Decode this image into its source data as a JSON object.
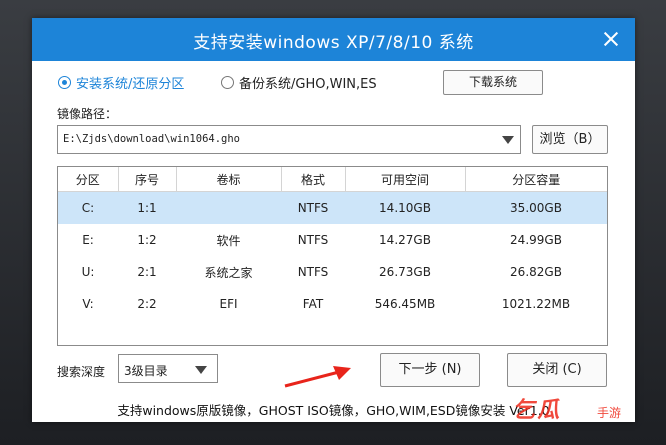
{
  "window": {
    "title": "支持安装windows XP/7/8/10 系统"
  },
  "mode": {
    "option_install": "安装系统/还原分区",
    "option_backup": "备份系统/GHO,WIN,ES",
    "selected": "option_install",
    "download_button": "下载系统"
  },
  "image_path": {
    "label": "镜像路径：",
    "value": "E:\\Zjds\\download\\win1064.gho",
    "browse_button": "浏览（B）"
  },
  "partitions": {
    "columns": [
      "分区",
      "序号",
      "卷标",
      "格式",
      "可用空间",
      "分区容量"
    ],
    "rows": [
      {
        "drive": "C:",
        "index": "1:1",
        "label": "",
        "fs": "NTFS",
        "free": "14.10GB",
        "size": "35.00GB",
        "selected": true
      },
      {
        "drive": "E:",
        "index": "1:2",
        "label": "软件",
        "fs": "NTFS",
        "free": "14.27GB",
        "size": "24.99GB",
        "selected": false
      },
      {
        "drive": "U:",
        "index": "2:1",
        "label": "系统之家",
        "fs": "NTFS",
        "free": "26.73GB",
        "size": "26.82GB",
        "selected": false
      },
      {
        "drive": "V:",
        "index": "2:2",
        "label": "EFI",
        "fs": "FAT",
        "free": "546.45MB",
        "size": "1021.22MB",
        "selected": false
      }
    ]
  },
  "search": {
    "label": "搜索深度",
    "value": "3级目录"
  },
  "buttons": {
    "next": "下一步 (N)",
    "close": "关闭 (C)"
  },
  "footer": {
    "text": "支持windows原版镜像，GHOST ISO镜像，GHO,WIM,ESD镜像安装 Ver1.0"
  },
  "watermark": {
    "text": "乞瓜",
    "sub": "手游"
  },
  "colors": {
    "titlebar": "#1d84d8",
    "accent": "#1d84d8",
    "selected_row": "#cde5f9",
    "arrow": "#e8241b"
  }
}
